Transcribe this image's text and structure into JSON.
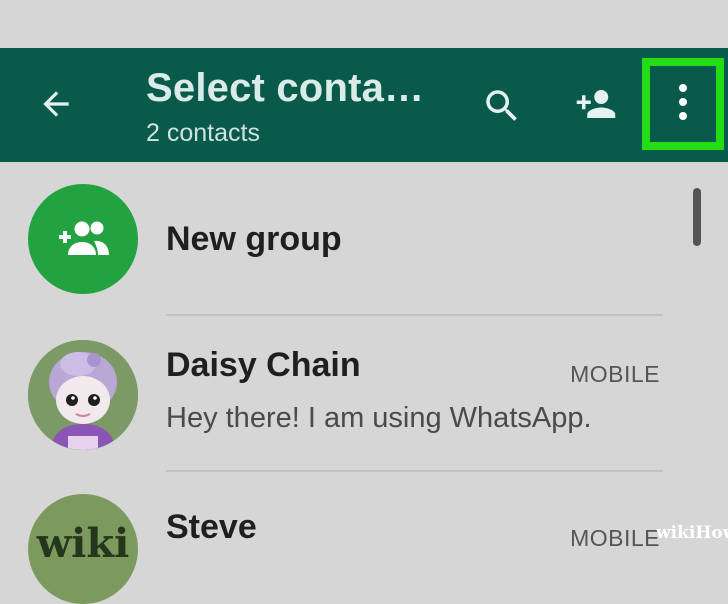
{
  "toolbar": {
    "title": "Select conta…",
    "subtitle": "2 contacts",
    "icons": [
      "arrow-back-icon",
      "search-icon",
      "add-person-icon",
      "more-vert-icon"
    ],
    "color": "#0a5a4c",
    "highlight_color": "#22dd13"
  },
  "list": {
    "new_group": {
      "label": "New group",
      "icon": "add-group-icon",
      "color": "#22a33f"
    },
    "contacts": [
      {
        "name": "Daisy Chain",
        "status": "Hey there! I am using WhatsApp.",
        "type": "MOBILE"
      },
      {
        "name": "Steve",
        "type": "MOBILE",
        "avatar_text": "wiki"
      }
    ]
  },
  "watermark": "wikiHow"
}
